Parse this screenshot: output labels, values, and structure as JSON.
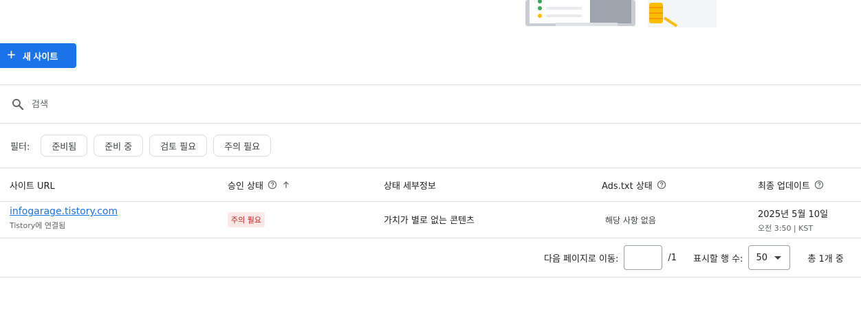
{
  "toolbar": {
    "new_site_label": "새 사이트",
    "plus_icon": "plus-icon"
  },
  "search": {
    "placeholder": "검색",
    "icon": "search-icon"
  },
  "filters": {
    "label": "필터:",
    "chips": [
      "준비됨",
      "준비 중",
      "검토 필요",
      "주의 필요"
    ]
  },
  "table": {
    "columns": {
      "site_url": "사이트 URL",
      "approval_status": "승인 상태",
      "status_details": "상태 세부정보",
      "ads_txt_status": "Ads.txt 상태",
      "last_updated": "최종 업데이트"
    },
    "rows": [
      {
        "site": "infogarage.tistory.com",
        "connected": "Tistory에 연결됨",
        "approval": "주의 필요",
        "details": "가치가 별로 없는 콘텐츠",
        "ads_txt": "해당 사항 없음",
        "date": "2025년 5월 10일",
        "time": "오전 3:50 | KST"
      }
    ]
  },
  "pagination": {
    "goto_label": "다음 페이지로 이동:",
    "page_value": "",
    "total_pages": "/1",
    "rows_label": "표시할 행 수:",
    "rows_value": "50",
    "total": "총 1개 중"
  },
  "colors": {
    "primary": "#1a73e8",
    "warning_bg": "#fce8e6",
    "warning_text": "#c5221f"
  }
}
